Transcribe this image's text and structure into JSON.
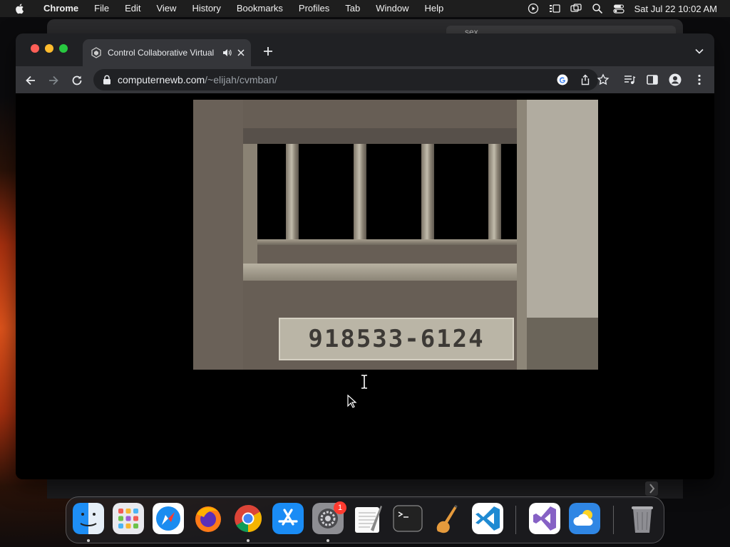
{
  "menubar": {
    "app_name": "Chrome",
    "items": [
      "File",
      "Edit",
      "View",
      "History",
      "Bookmarks",
      "Profiles",
      "Tab",
      "Window",
      "Help"
    ],
    "clock": "Sat Jul 22  10:02 AM"
  },
  "background_window": {
    "search_text": "sex"
  },
  "browser": {
    "tab_title": "Control Collaborative Virtual",
    "url_host": "computernewb.com",
    "url_path": "/~elijah/cvmban/"
  },
  "scene": {
    "plate_text": "918533-6124"
  },
  "dock": {
    "apps": [
      "Finder",
      "Launchpad",
      "Safari",
      "Firefox",
      "Google Chrome",
      "App Store",
      "System Settings",
      "TextEdit",
      "Terminal",
      "GarageBand",
      "Visual Studio Code",
      "Visual Studio",
      "Weather",
      "Trash"
    ],
    "settings_badge": "1"
  },
  "colors": {
    "tab_bg": "#35363a",
    "toolbar_bg": "#35363a",
    "tabstrip_bg": "#202124",
    "omnibox_bg": "#202124"
  }
}
